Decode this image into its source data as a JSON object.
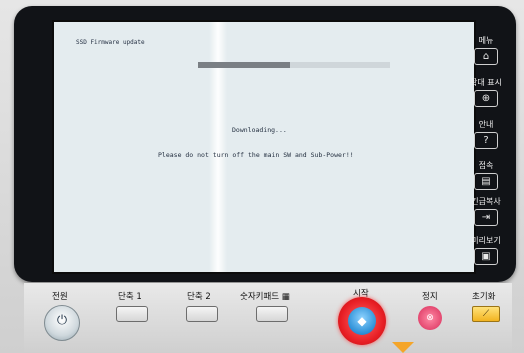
{
  "screen": {
    "title": "SSD Firmware update",
    "progress_fraction": 0.48,
    "status_text": "Downloading...",
    "warning_text": "Please do not turn off the main SW and Sub-Power!!"
  },
  "side_menu": [
    {
      "label": "메뉴",
      "icon": "home-icon",
      "glyph": "⌂"
    },
    {
      "label": "확대 표시",
      "icon": "zoom-icon",
      "glyph": "⊕"
    },
    {
      "label": "안내",
      "icon": "help-icon",
      "glyph": "?"
    },
    {
      "label": "접속",
      "icon": "access-icon",
      "glyph": "▤"
    },
    {
      "label": "긴급복사",
      "icon": "copy-icon",
      "glyph": "⇥"
    },
    {
      "label": "미리보기",
      "icon": "preview-icon",
      "glyph": "▣"
    }
  ],
  "panel": {
    "power_label": "전원",
    "shortcut1_label": "단축 1",
    "shortcut2_label": "단축 2",
    "keypad_label": "숫자키패드 ▦",
    "start_label": "시작",
    "stop_label": "정지",
    "reset_label": "초기화"
  }
}
